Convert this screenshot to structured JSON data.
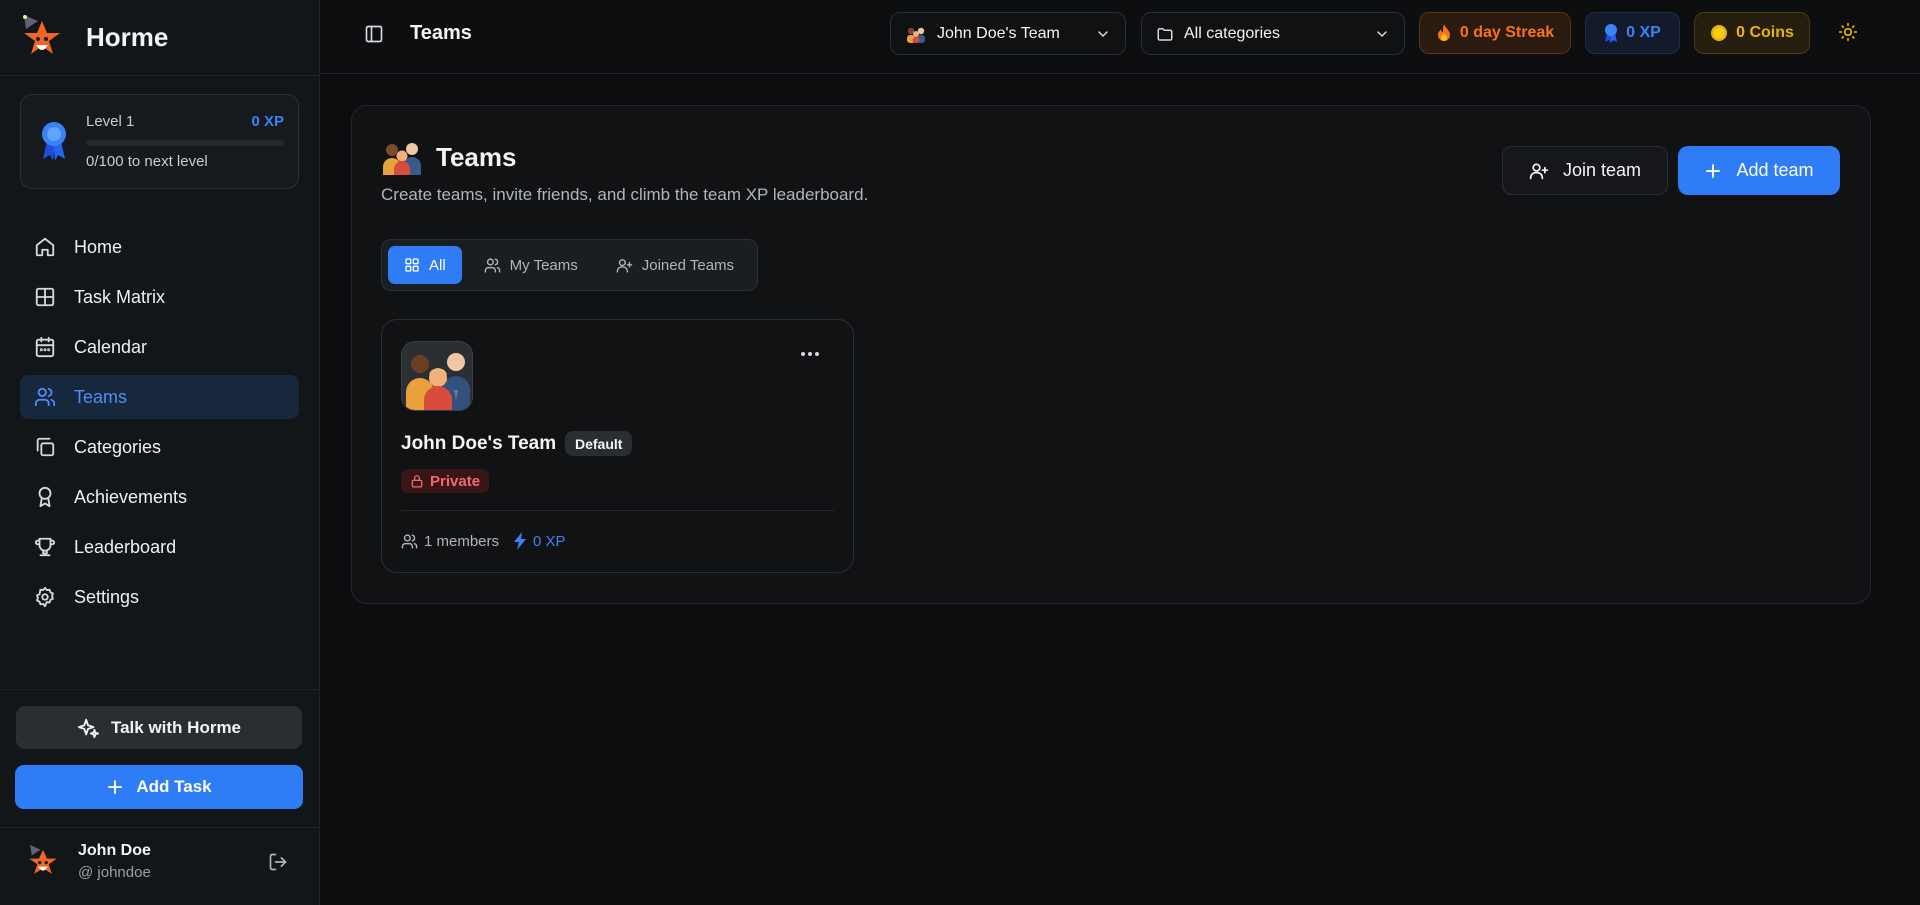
{
  "app": {
    "brand_name": "Horme"
  },
  "level": {
    "label": "Level 1",
    "xp": "0 XP",
    "progress_text": "0/100 to next level",
    "progress_fraction": 0
  },
  "nav": {
    "items": [
      {
        "label": "Home",
        "icon": "home-icon"
      },
      {
        "label": "Task Matrix",
        "icon": "grid-icon"
      },
      {
        "label": "Calendar",
        "icon": "calendar-icon"
      },
      {
        "label": "Teams",
        "icon": "users-icon",
        "active": true
      },
      {
        "label": "Categories",
        "icon": "copy-icon"
      },
      {
        "label": "Achievements",
        "icon": "award-icon"
      },
      {
        "label": "Leaderboard",
        "icon": "trophy-icon"
      },
      {
        "label": "Settings",
        "icon": "gear-icon"
      }
    ]
  },
  "sidebar_actions": {
    "talk_label": "Talk with Horme",
    "add_task_label": "Add Task"
  },
  "user": {
    "name": "John Doe",
    "handle": "@ johndoe"
  },
  "header": {
    "title": "Teams",
    "team_select": "John Doe's Team",
    "category_select": "All categories",
    "streak": "0 day Streak",
    "xp": "0 XP",
    "coins": "0 Coins"
  },
  "page": {
    "title": "Teams",
    "subtitle": "Create teams, invite friends, and climb the team XP leaderboard.",
    "join_label": "Join team",
    "add_label": "Add team"
  },
  "tabs": [
    {
      "label": "All",
      "active": true
    },
    {
      "label": "My Teams"
    },
    {
      "label": "Joined Teams"
    }
  ],
  "team_card": {
    "name": "John Doe's Team",
    "default_badge": "Default",
    "privacy": "Private",
    "members": "1 members",
    "xp": "0 XP"
  },
  "colors": {
    "accent": "#2f7df6",
    "streak": "#f97316",
    "coins": "#eab308",
    "private": "#f06a6a"
  }
}
